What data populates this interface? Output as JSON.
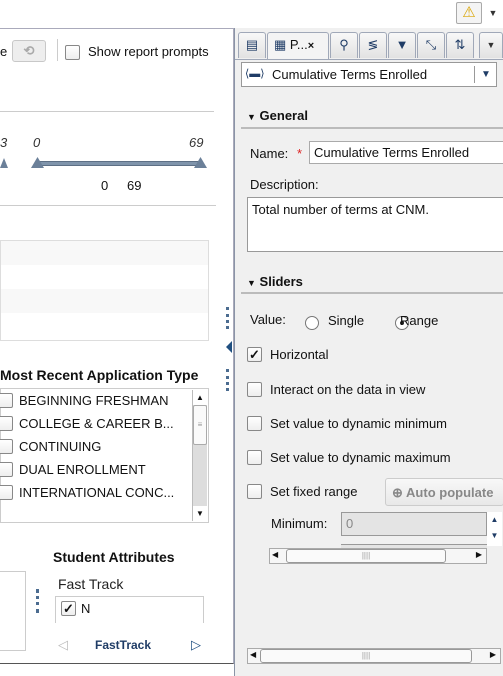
{
  "report": {
    "partial_label": "e",
    "show_prompts_label": "Show report prompts",
    "slider_left_partial": "3",
    "slider": {
      "min_label": "0",
      "max_label": "69",
      "low": "0",
      "high": "69",
      "fraction_low": 0,
      "fraction_high": 1
    },
    "app_type": {
      "title": "Most Recent Application Type",
      "items": [
        "BEGINNING FRESHMAN",
        "COLLEGE & CAREER B...",
        "CONTINUING",
        "DUAL ENROLLMENT",
        "INTERNATIONAL CONC..."
      ]
    },
    "student_attributes": {
      "title": "Student Attributes",
      "subtitle": "Fast Track",
      "items": [
        {
          "label": "N",
          "checked": true
        }
      ],
      "pager_label": "FastTrack"
    }
  },
  "panel": {
    "active_tab": "P...",
    "selected_object": "Cumulative Terms Enrolled",
    "general": {
      "title": "General",
      "name_label": "Name:",
      "required_mark": "*",
      "name_value": "Cumulative Terms Enrolled",
      "description_label": "Description:",
      "description_value": "Total number of terms at CNM."
    },
    "sliders": {
      "title": "Sliders",
      "value_label": "Value:",
      "single_label": "Single",
      "range_label": "Range",
      "selected": "Range",
      "horizontal_label": "Horizontal",
      "horizontal_checked": true,
      "interact_label": "Interact on the data in view",
      "dyn_min_label": "Set value to dynamic minimum",
      "dyn_max_label": "Set value to dynamic maximum",
      "fixed_range_label": "Set fixed range",
      "auto_populate_label": "Auto populate",
      "minimum_label": "Minimum:",
      "minimum_value": "0"
    }
  },
  "colors": {
    "accent": "#1f4f80",
    "warning": "#f2c200",
    "required": "#d22"
  }
}
